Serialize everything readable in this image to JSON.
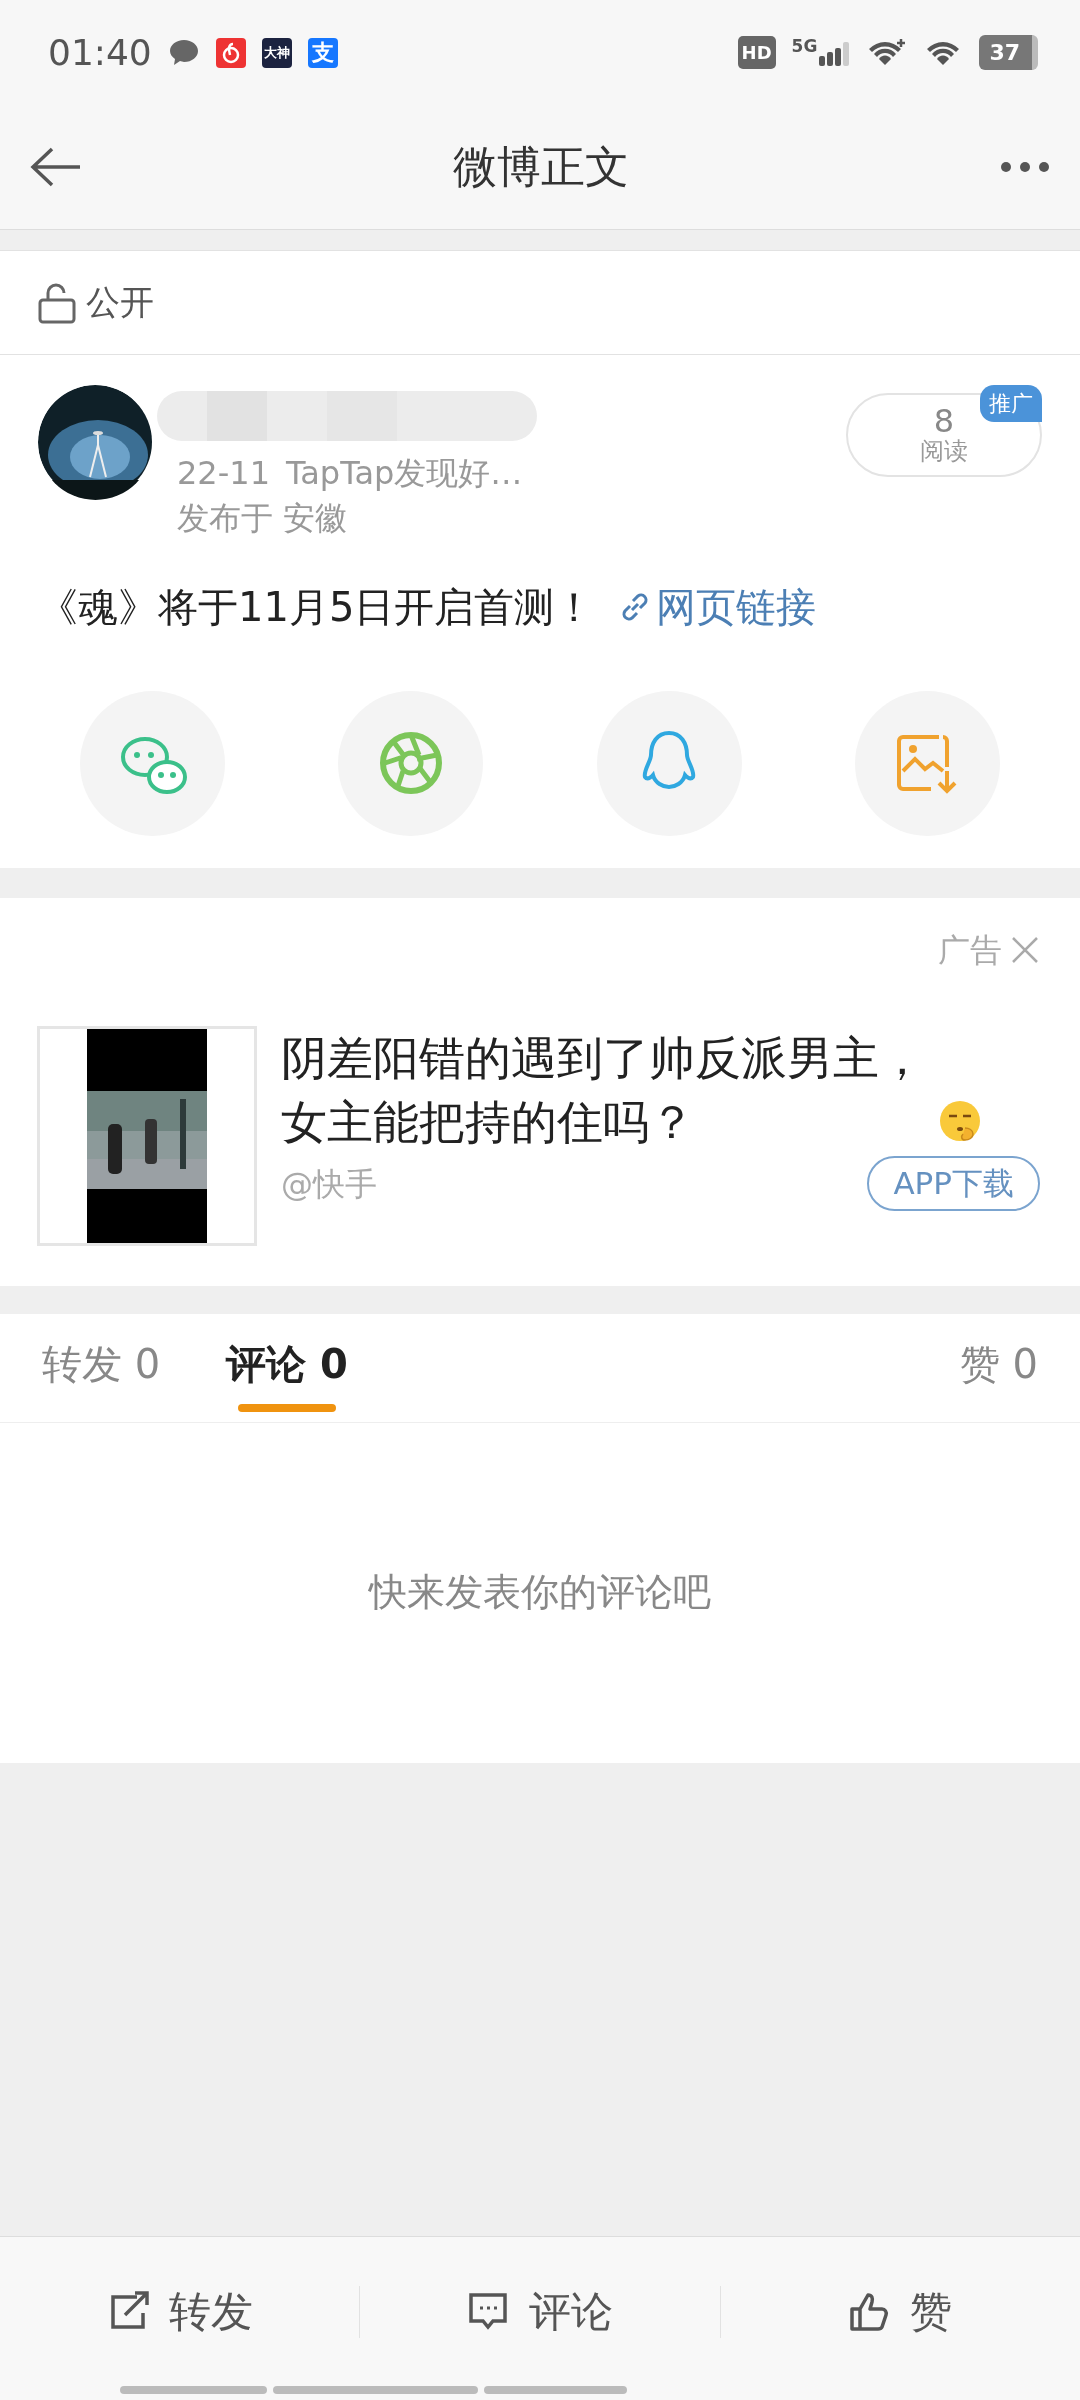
{
  "status_bar": {
    "time": "01:40",
    "notification_apps": [
      {
        "kind": "message"
      },
      {
        "kind": "netease"
      },
      {
        "kind": "dashen",
        "label": "大神"
      },
      {
        "kind": "alipay",
        "label": "支"
      }
    ],
    "hd": "HD",
    "network": "5G",
    "battery": "37"
  },
  "header": {
    "title": "微博正文"
  },
  "visibility": {
    "label": "公开"
  },
  "post": {
    "time": "22-11",
    "source": "TapTap发现好…",
    "location": "发布于 安徽",
    "read_count": "8",
    "read_label": "阅读",
    "promo_tag": "推广",
    "text": "《魂》将于11月5日开启首测！",
    "link": "网页链接",
    "share": [
      {
        "kind": "wechat"
      },
      {
        "kind": "moments"
      },
      {
        "kind": "qq"
      },
      {
        "kind": "save-image"
      }
    ]
  },
  "ad": {
    "label": "广告",
    "title": "阴差阳错的遇到了帅反派男主，女主能把持的住吗？",
    "advertiser": "@快手",
    "button": "APP下载"
  },
  "tabs": [
    {
      "label": "转发 0",
      "selected": false
    },
    {
      "label": "评论 0",
      "selected": true
    },
    {
      "label": "赞 0",
      "selected": false
    }
  ],
  "empty_message": "快来发表你的评论吧",
  "actions": [
    {
      "kind": "repost",
      "label": "转发"
    },
    {
      "kind": "comment",
      "label": "评论"
    },
    {
      "kind": "like",
      "label": "赞"
    }
  ]
}
